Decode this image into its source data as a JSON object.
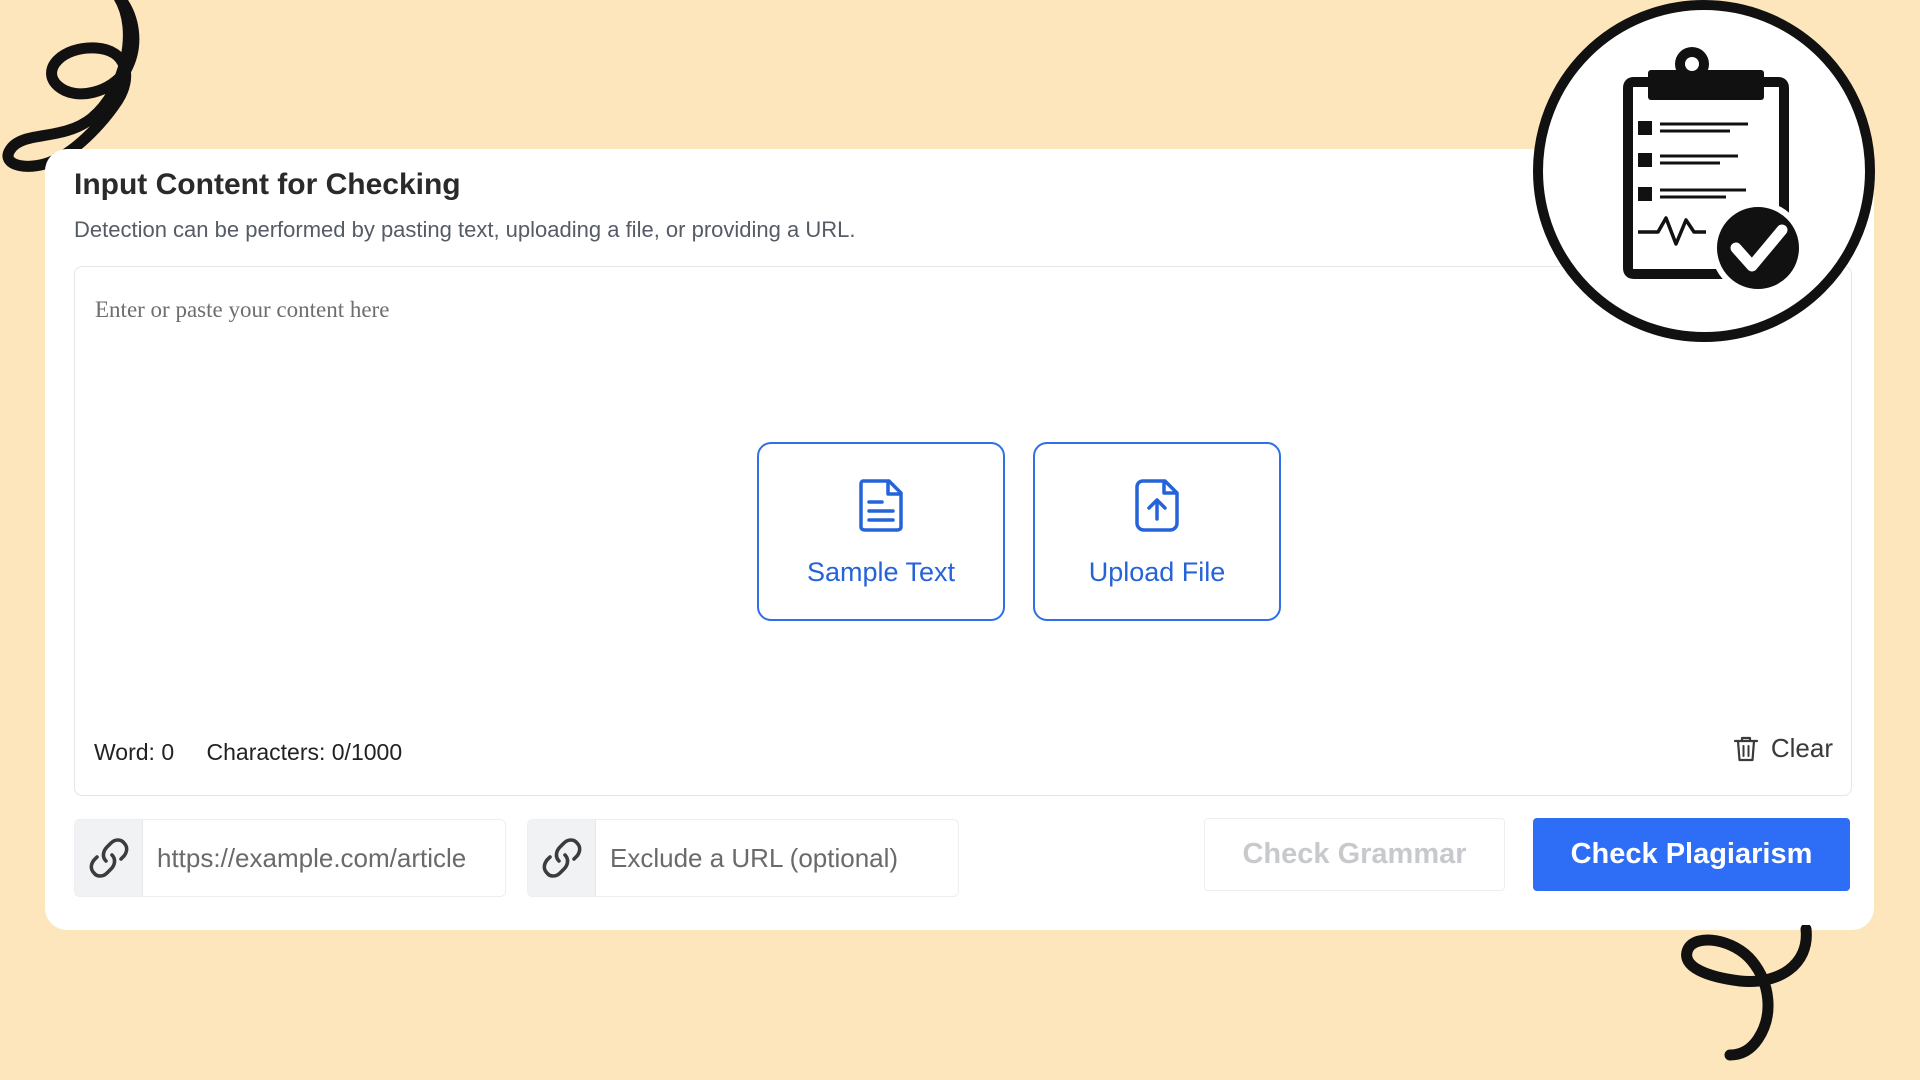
{
  "card": {
    "title": "Input Content for Checking",
    "subtitle": "Detection can be performed by pasting text, uploading a file, or providing a URL."
  },
  "editor": {
    "placeholder": "Enter or paste your content here",
    "sample_label": "Sample Text",
    "upload_label": "Upload File",
    "word_count": "Word: 0",
    "char_count": "Characters: 0/1000",
    "clear_label": "Clear"
  },
  "url": {
    "main_placeholder": "https://example.com/article",
    "exclude_placeholder": "Exclude a URL (optional)"
  },
  "actions": {
    "grammar_label": "Check Grammar",
    "plagiarism_label": "Check Plagiarism"
  },
  "colors": {
    "background": "#fde5bc",
    "accent": "#2e6df6",
    "icon_blue": "#2563d9"
  },
  "icons": {
    "badge": "clipboard-check-icon",
    "sample": "document-icon",
    "upload": "file-upload-icon",
    "clear": "trash-icon",
    "url": "link-icon"
  }
}
